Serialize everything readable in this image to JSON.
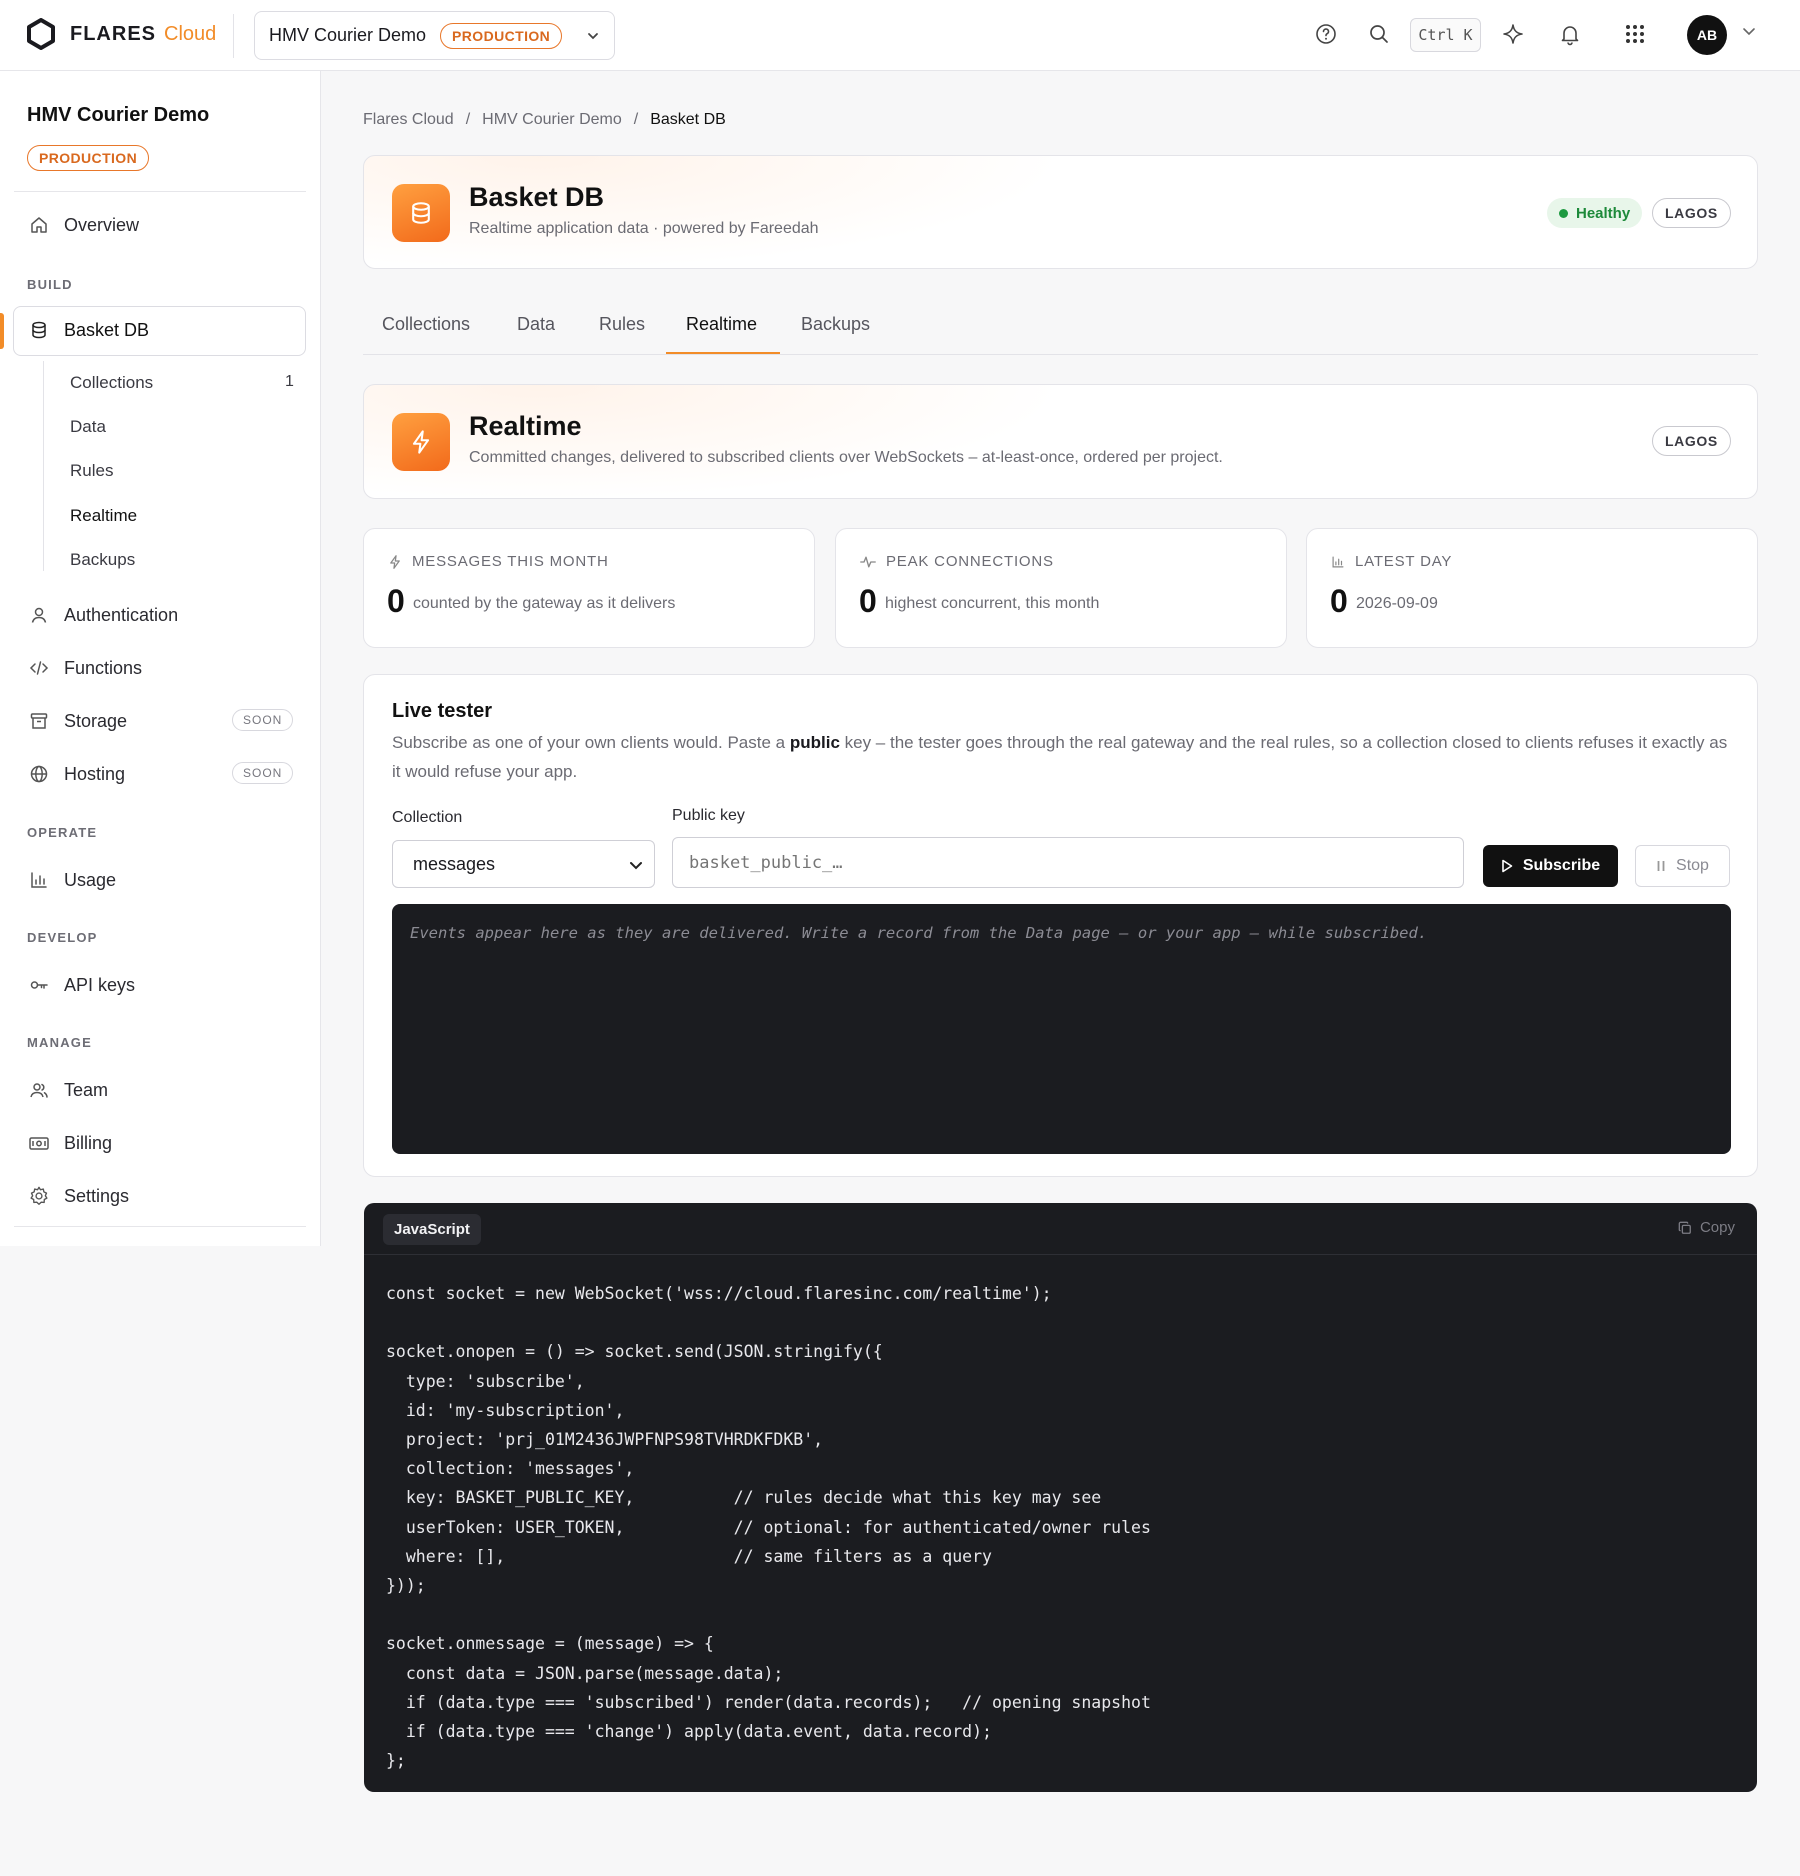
{
  "topbar": {
    "brand": "FLARES",
    "brand_suffix": "Cloud",
    "project_name": "HMV Courier Demo",
    "env_badge": "PRODUCTION",
    "shortcut": "Ctrl K",
    "avatar_initials": "AB"
  },
  "sidebar": {
    "project_title": "HMV Courier Demo",
    "env_badge": "PRODUCTION",
    "overview": "Overview",
    "section_build": "BUILD",
    "basket_db": "Basket DB",
    "sub": {
      "collections": "Collections",
      "collections_count": "1",
      "data": "Data",
      "rules": "Rules",
      "realtime": "Realtime",
      "backups": "Backups"
    },
    "authentication": "Authentication",
    "functions": "Functions",
    "storage": "Storage",
    "hosting": "Hosting",
    "soon": "SOON",
    "section_operate": "OPERATE",
    "usage": "Usage",
    "section_develop": "DEVELOP",
    "api_keys": "API keys",
    "section_manage": "MANAGE",
    "team": "Team",
    "billing": "Billing",
    "settings": "Settings"
  },
  "breadcrumb": {
    "items": [
      "Flares Cloud",
      "HMV Courier Demo",
      "Basket DB"
    ],
    "separator": "/"
  },
  "header": {
    "title": "Basket DB",
    "subtitle": "Realtime application data · powered by Fareedah",
    "status": "Healthy",
    "region": "LAGOS"
  },
  "tabs": [
    "Collections",
    "Data",
    "Rules",
    "Realtime",
    "Backups"
  ],
  "realtime": {
    "title": "Realtime",
    "subtitle": "Committed changes, delivered to subscribed clients over WebSockets – at-least-once, ordered per project.",
    "region": "LAGOS"
  },
  "stats": [
    {
      "label": "MESSAGES THIS MONTH",
      "value": "0",
      "desc": "counted by the gateway as it delivers"
    },
    {
      "label": "PEAK CONNECTIONS",
      "value": "0",
      "desc": "highest concurrent, this month"
    },
    {
      "label": "LATEST DAY",
      "value": "0",
      "desc": "2026-09-09"
    }
  ],
  "tester": {
    "title": "Live tester",
    "desc_a": "Subscribe as one of your own clients would. Paste a ",
    "desc_bold": "public",
    "desc_b": " key – the tester goes through the real gateway and the real rules, so a collection closed to clients refuses it exactly as it would refuse your app.",
    "collection_label": "Collection",
    "collection_value": "messages",
    "key_label": "Public key",
    "key_placeholder": "basket_public_…",
    "subscribe": "Subscribe",
    "stop": "Stop",
    "console_placeholder": "Events appear here as they are delivered. Write a record from the Data page — or your app — while subscribed."
  },
  "code": {
    "language": "JavaScript",
    "copy": "Copy",
    "source": "const socket = new WebSocket('wss://cloud.flaresinc.com/realtime');\n\nsocket.onopen = () => socket.send(JSON.stringify({\n  type: 'subscribe',\n  id: 'my-subscription',\n  project: 'prj_01M2436JWPFNPS98TVHRDKFDKB',\n  collection: 'messages',\n  key: BASKET_PUBLIC_KEY,          // rules decide what this key may see\n  userToken: USER_TOKEN,           // optional: for authenticated/owner rules\n  where: [],                       // same filters as a query\n}));\n\nsocket.onmessage = (message) => {\n  const data = JSON.parse(message.data);\n  if (data.type === 'subscribed') render(data.records);   // opening snapshot\n  if (data.type === 'change') apply(data.event, data.record);\n};"
  },
  "colors": {
    "accent": "#f28c28",
    "healthy": "#1d9a40",
    "code_bg": "#1b1c20"
  }
}
